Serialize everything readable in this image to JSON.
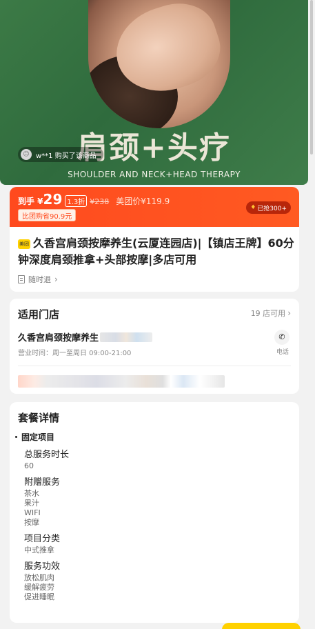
{
  "hero": {
    "title": "肩颈+头疗",
    "subtitle": "SHOULDER AND NECK+HEAD THERAPY",
    "buyer_text": "w**1 购买了该商品"
  },
  "price": {
    "prefix": "到手 ¥",
    "now": "29",
    "discount": "1.3折",
    "original": "¥238",
    "meituan_price": "美团价¥119.9",
    "savings": "比团购省90.9元",
    "sold": "已抢300+"
  },
  "deal": {
    "logo_text": "美团",
    "title": "久香宫肩颈按摩养生(云厦连园店)|【镇店王牌】60分钟深度肩颈推拿+头部按摩|多店可用",
    "refund_label": "随时退"
  },
  "store": {
    "heading": "适用门店",
    "count": "19 店可用",
    "name": "久香宫肩颈按摩养生",
    "hours": "营业时间：周一至周日 09:00-21:00",
    "phone_label": "电话"
  },
  "package": {
    "heading": "套餐详情",
    "section": "固定项目",
    "items": [
      {
        "label": "总服务时长",
        "values": [
          "60"
        ]
      },
      {
        "label": "附赠服务",
        "values": [
          "茶水",
          "果汁",
          "WIFI",
          "按摩"
        ]
      },
      {
        "label": "项目分类",
        "values": [
          "中式推拿"
        ]
      },
      {
        "label": "服务功效",
        "values": [
          "放松肌肉",
          "缓解疲劳",
          "促进睡眠"
        ]
      }
    ]
  }
}
